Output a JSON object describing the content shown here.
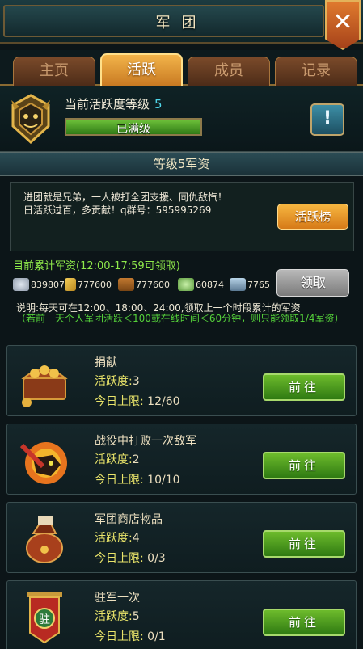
{
  "window": {
    "title": "军团",
    "close_icon": "close-icon"
  },
  "tabs": [
    {
      "label": "主页",
      "active": false
    },
    {
      "label": "活跃",
      "active": true
    },
    {
      "label": "成员",
      "active": false
    },
    {
      "label": "记录",
      "active": false
    }
  ],
  "level": {
    "label": "当前活跃度等级",
    "value": "5",
    "bar_text": "已满级",
    "bar_fill_fraction": 1.0,
    "info_button": "!"
  },
  "banner": "等级5军资",
  "notice": {
    "text": "进团就是兄弟，一人被打全团支援、同仇敌忾！\n日活跃过百，多贡献！q群号：595995269",
    "rank_button": "活跃榜"
  },
  "funds": {
    "title": "目前累计军资(12:00-17:59可领取)",
    "items": [
      {
        "icon": "coin-icon",
        "value": "839807"
      },
      {
        "icon": "feather-icon",
        "value": "777600"
      },
      {
        "icon": "wood-icon",
        "value": "777600"
      },
      {
        "icon": "jade-icon",
        "value": "60874"
      },
      {
        "icon": "iron-icon",
        "value": "7765"
      }
    ],
    "claim_button": "领取",
    "desc": "说明:每天可在12:00、18:00、24:00,领取上一个时段累计的军资",
    "warning": "（若前一天个人军团活跃＜100或在线时间＜60分钟，则只能领取1/4军资）"
  },
  "tasks": [
    {
      "name": "捐献",
      "activity_label": "活跃度:",
      "activity": "3",
      "limit_label": "今日上限:",
      "limit": "12/60",
      "button": "前往",
      "icon": "chest-icon"
    },
    {
      "name": "战役中打败一次敌军",
      "activity_label": "活跃度:",
      "activity": "2",
      "limit_label": "今日上限:",
      "limit": "10/10",
      "button": "前往",
      "icon": "battle-icon"
    },
    {
      "name": "军团商店物品",
      "activity_label": "活跃度:",
      "activity": "4",
      "limit_label": "今日上限:",
      "limit": "0/3",
      "button": "前往",
      "icon": "bag-icon"
    },
    {
      "name": "驻军一次",
      "activity_label": "活跃度:",
      "activity": "5",
      "limit_label": "今日上限:",
      "limit": "0/1",
      "button": "前往",
      "icon": "banner-icon",
      "icon_text": "驻"
    }
  ]
}
